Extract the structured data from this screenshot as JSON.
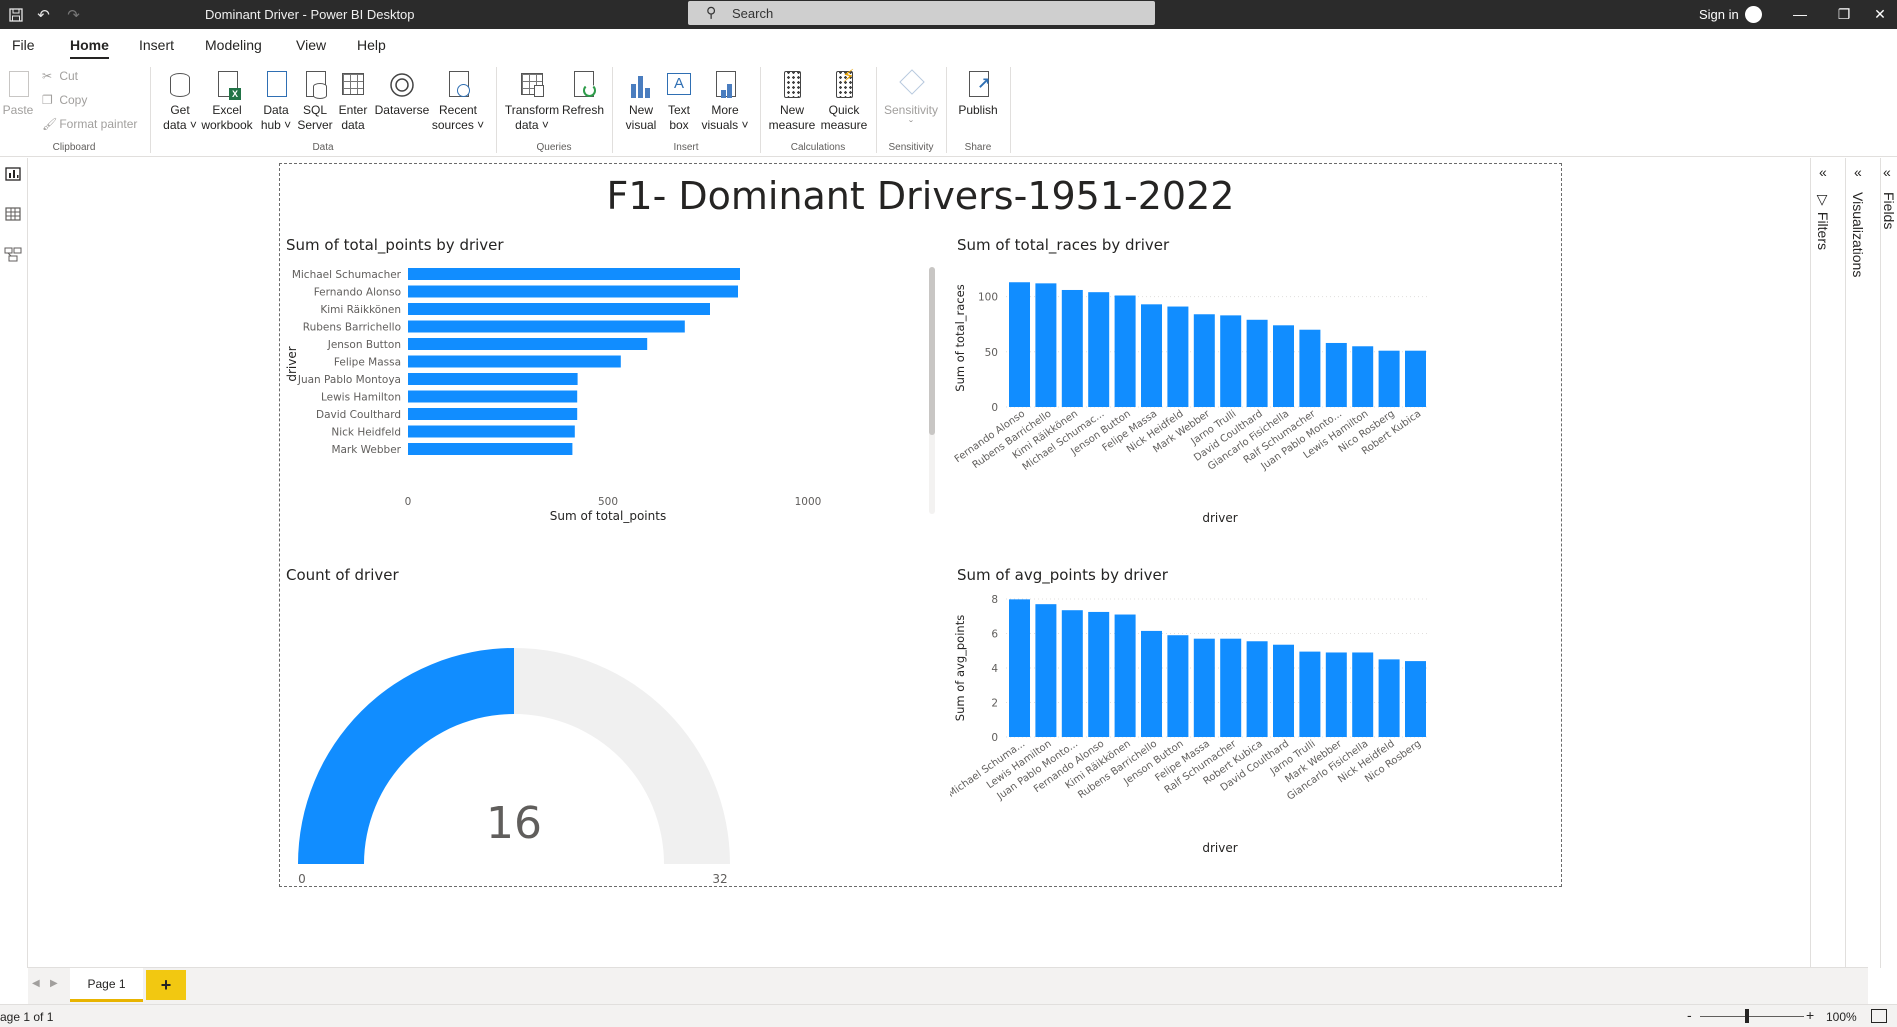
{
  "app": {
    "title": "Dominant Driver - Power BI Desktop",
    "search_placeholder": "Search",
    "sign_in": "Sign in"
  },
  "tabs": [
    "File",
    "Home",
    "Insert",
    "Modeling",
    "View",
    "Help"
  ],
  "ribbon": {
    "clipboard": {
      "paste": "Paste",
      "cut": "Cut",
      "copy": "Copy",
      "format_painter": "Format painter",
      "group": "Clipboard"
    },
    "data": {
      "get_data": [
        "Get",
        "data ˅"
      ],
      "excel": [
        "Excel",
        "workbook"
      ],
      "data_hub": [
        "Data",
        "hub ˅"
      ],
      "sql": [
        "SQL",
        "Server"
      ],
      "enter": [
        "Enter",
        "data"
      ],
      "dataverse": "Dataverse",
      "recent": [
        "Recent",
        "sources ˅"
      ],
      "group": "Data"
    },
    "queries": {
      "transform": [
        "Transform",
        "data ˅"
      ],
      "refresh": "Refresh",
      "group": "Queries"
    },
    "insert": {
      "new_visual": [
        "New",
        "visual"
      ],
      "text_box": [
        "Text",
        "box"
      ],
      "more_visuals": [
        "More",
        "visuals ˅"
      ],
      "group": "Insert"
    },
    "calculations": {
      "new_measure": [
        "New",
        "measure"
      ],
      "quick_measure": [
        "Quick",
        "measure"
      ],
      "group": "Calculations"
    },
    "sensitivity": {
      "label": "Sensitivity",
      "group": "Sensitivity"
    },
    "share": {
      "publish": "Publish",
      "group": "Share"
    }
  },
  "panes": {
    "filters": "Filters",
    "visualizations": "Visualizations",
    "fields": "Fields"
  },
  "report": {
    "title": "F1- Dominant Drivers-1951-2022"
  },
  "chart_data": [
    {
      "type": "bar",
      "orientation": "horizontal",
      "title": "Sum of total_points by driver",
      "xlabel": "Sum of total_points",
      "ylabel": "driver",
      "xlim": [
        0,
        1000
      ],
      "ticks": [
        "0",
        "500",
        "1000"
      ],
      "categories": [
        "Michael Schumacher",
        "Fernando Alonso",
        "Kimi Räikkönen",
        "Rubens Barrichello",
        "Jenson Button",
        "Felipe Massa",
        "Juan Pablo Montoya",
        "Lewis Hamilton",
        "David Coulthard",
        "Nick Heidfeld",
        "Mark Webber"
      ],
      "values": [
        830,
        825,
        755,
        692,
        598,
        532,
        424,
        423,
        423,
        417,
        411
      ],
      "color": "#118DFF"
    },
    {
      "type": "bar",
      "title": "Sum of total_races by driver",
      "xlabel": "driver",
      "ylabel": "Sum of total_races",
      "ylim": [
        0,
        125
      ],
      "ticks": [
        "0",
        "50",
        "100"
      ],
      "categories": [
        "Fernando Alonso",
        "Rubens Barrichello",
        "Kimi Räikkönen",
        "Michael Schumac...",
        "Jenson Button",
        "Felipe Massa",
        "Nick Heidfeld",
        "Mark Webber",
        "Jarno Trulli",
        "David Coulthard",
        "Giancarlo Fisichella",
        "Ralf Schumacher",
        "Juan Pablo Monto...",
        "Lewis Hamilton",
        "Nico Rosberg",
        "Robert Kubica"
      ],
      "values": [
        113,
        112,
        106,
        104,
        101,
        93,
        91,
        84,
        83,
        79,
        74,
        70,
        58,
        55,
        51,
        51
      ],
      "color": "#118DFF"
    },
    {
      "type": "gauge",
      "title": "Count of driver",
      "value": 16,
      "min": 0,
      "max": 32,
      "value_label": "16",
      "min_label": "0",
      "max_label": "32",
      "color": "#118DFF"
    },
    {
      "type": "bar",
      "title": "Sum of avg_points by driver",
      "xlabel": "driver",
      "ylabel": "Sum of avg_points",
      "ylim": [
        0,
        8
      ],
      "ticks": [
        "0",
        "2",
        "4",
        "6",
        "8"
      ],
      "categories": [
        "Michael Schuma...",
        "Lewis Hamilton",
        "Juan Pablo Monto...",
        "Fernando Alonso",
        "Kimi Räikkönen",
        "Rubens Barrichello",
        "Jenson Button",
        "Felipe Massa",
        "Ralf Schumacher",
        "Robert Kubica",
        "David Coulthard",
        "Jarno Trulli",
        "Mark Webber",
        "Giancarlo Fisichella",
        "Nick Heidfeld",
        "Nico Rosberg"
      ],
      "values": [
        7.98,
        7.7,
        7.35,
        7.25,
        7.1,
        6.15,
        5.9,
        5.7,
        5.7,
        5.55,
        5.35,
        4.95,
        4.9,
        4.9,
        4.5,
        4.4
      ],
      "color": "#118DFF"
    }
  ],
  "bottom": {
    "page_tab": "Page 1",
    "add_page": "+",
    "status": "age 1 of 1",
    "zoom": "100%",
    "zoom_minus": "-",
    "zoom_plus": "+"
  }
}
